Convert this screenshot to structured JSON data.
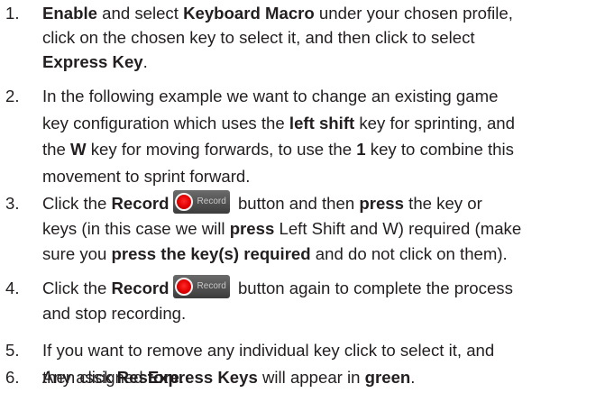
{
  "steps": [
    {
      "number": "1.",
      "lines": [
        [
          {
            "t": "Enable",
            "b": true
          },
          {
            "t": " and select "
          },
          {
            "t": "Keyboard Macro",
            "b": true
          },
          {
            "t": " under your chosen profile,"
          }
        ],
        [
          {
            "t": "click on the chosen key to select it, and then click to select"
          }
        ],
        [
          {
            "t": "Express Key",
            "b": true
          },
          {
            "t": "."
          }
        ]
      ]
    },
    {
      "number": "2.",
      "lines": [
        [
          {
            "t": "In the following example we want to change an existing game"
          }
        ],
        [
          {
            "t": "key configuration which uses the "
          },
          {
            "t": "left shift",
            "b": true
          },
          {
            "t": " key for sprinting, and"
          }
        ],
        [
          {
            "t": "the "
          },
          {
            "t": "W",
            "b": true
          },
          {
            "t": " key for moving forwards, to use the "
          },
          {
            "t": "1",
            "b": true
          },
          {
            "t": " key to combine this"
          }
        ],
        [
          {
            "t": "movement to sprint forward."
          }
        ]
      ]
    },
    {
      "number": "3.",
      "lines": [
        [
          {
            "t": "Click the "
          },
          {
            "t": "Record",
            "b": true
          },
          {
            "rec": true
          },
          {
            "t": " button and then "
          },
          {
            "t": "press",
            "b": true
          },
          {
            "t": " the key or"
          }
        ],
        [
          {
            "t": "keys (in this case we will "
          },
          {
            "t": "press",
            "b": true
          },
          {
            "t": " Left Shift and W) required (make"
          }
        ],
        [
          {
            "t": "sure you "
          },
          {
            "t": "press the key(s) required",
            "b": true
          },
          {
            "t": " and do not click on them)."
          }
        ]
      ]
    },
    {
      "number": "4.",
      "lines": [
        [
          {
            "t": "Click the "
          },
          {
            "t": "Record",
            "b": true
          },
          {
            "rec": true
          },
          {
            "t": " button again to complete the process"
          }
        ],
        [
          {
            "t": "and stop recording."
          }
        ]
      ]
    },
    {
      "number": "5.",
      "lines": [
        [
          {
            "t": "If you want to remove any individual key click to select it, and"
          }
        ],
        [
          {
            "t": "then click "
          },
          {
            "t": "Restore",
            "b": true
          },
          {
            "t": "."
          }
        ]
      ]
    },
    {
      "number": "6.",
      "lines": [
        [
          {
            "t": "Any assigned "
          },
          {
            "t": "Express Keys",
            "b": true
          },
          {
            "t": " will appear in "
          },
          {
            "t": "green",
            "b": true
          },
          {
            "t": "."
          }
        ]
      ]
    }
  ],
  "record_button": {
    "label": "Record",
    "icon": "record-icon"
  }
}
